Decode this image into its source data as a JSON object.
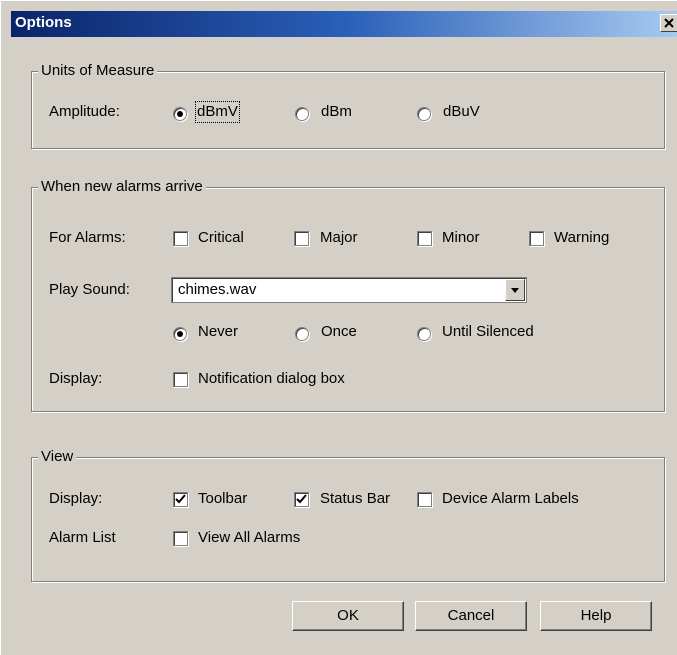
{
  "window": {
    "title": "Options"
  },
  "units": {
    "group_label": "Units of Measure",
    "amplitude_label": "Amplitude:",
    "options": [
      {
        "label": "dBmV",
        "selected": true
      },
      {
        "label": "dBm",
        "selected": false
      },
      {
        "label": "dBuV",
        "selected": false
      }
    ]
  },
  "alarms": {
    "group_label": "When new alarms arrive",
    "for_alarms_label": "For Alarms:",
    "severities": [
      {
        "label": "Critical",
        "checked": false
      },
      {
        "label": "Major",
        "checked": false
      },
      {
        "label": "Minor",
        "checked": false
      },
      {
        "label": "Warning",
        "checked": false
      }
    ],
    "play_sound_label": "Play Sound:",
    "sound_file": "chimes.wav",
    "repeat_options": [
      {
        "label": "Never",
        "selected": true
      },
      {
        "label": "Once",
        "selected": false
      },
      {
        "label": "Until Silenced",
        "selected": false
      }
    ],
    "display_label": "Display:",
    "notification_label": "Notification dialog box",
    "notification_checked": false
  },
  "view": {
    "group_label": "View",
    "display_label": "Display:",
    "display_options": [
      {
        "label": "Toolbar",
        "checked": true
      },
      {
        "label": "Status Bar",
        "checked": true
      },
      {
        "label": "Device Alarm Labels",
        "checked": false
      }
    ],
    "alarm_list_label": "Alarm List",
    "view_all_label": "View All Alarms",
    "view_all_checked": false
  },
  "buttons": {
    "ok": "OK",
    "cancel": "Cancel",
    "help": "Help"
  }
}
